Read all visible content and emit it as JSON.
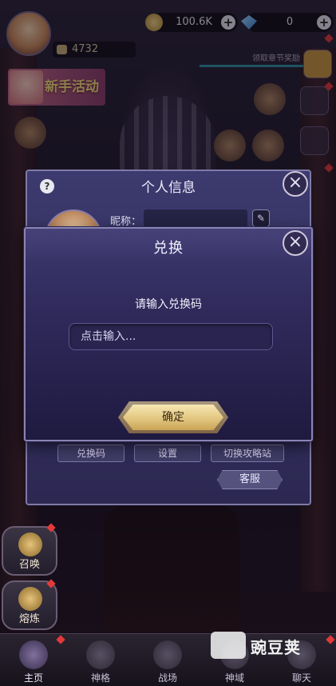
{
  "top_bar": {
    "power": "4732",
    "gold": "100.6K",
    "gems": "0",
    "chapter_reward": "领取章节奖励"
  },
  "event": {
    "newbie_label": "新手活动"
  },
  "info_panel": {
    "title": "个人信息",
    "help": "?",
    "nickname_label": "昵称：",
    "btn_code": "兑换码",
    "btn_settings": "设置",
    "btn_domain": "切换攻略站",
    "service": "客服"
  },
  "redeem": {
    "title": "兑换",
    "prompt": "请输入兑换码",
    "placeholder": "点击输入...",
    "confirm": "确定"
  },
  "side": {
    "summon": "召唤",
    "forge": "熔炼"
  },
  "nav": {
    "items": [
      {
        "label": "主页"
      },
      {
        "label": "神格"
      },
      {
        "label": "战场"
      },
      {
        "label": "神域"
      },
      {
        "label": "聊天"
      }
    ]
  },
  "watermark": "豌豆荚"
}
